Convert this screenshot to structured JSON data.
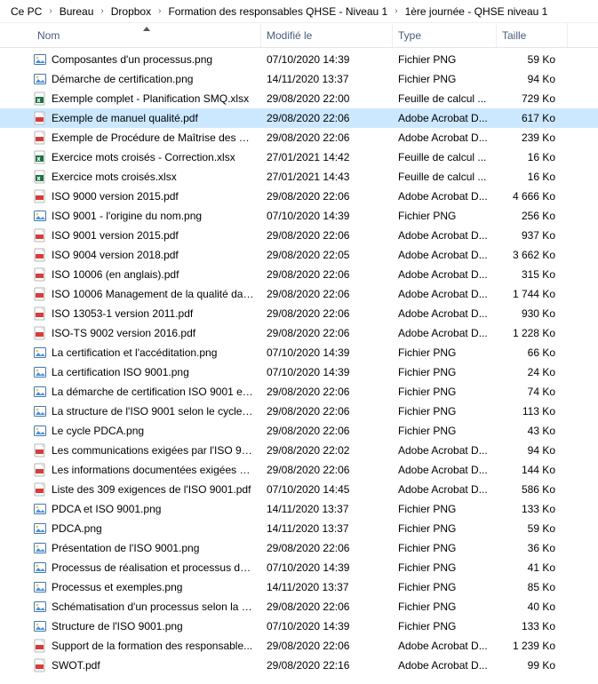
{
  "breadcrumb": [
    "Ce PC",
    "Bureau",
    "Dropbox",
    "Formation des responsables QHSE - Niveau 1",
    "1ère journée - QHSE niveau 1"
  ],
  "columns": {
    "name": "Nom",
    "modified": "Modifié le",
    "type": "Type",
    "size": "Taille"
  },
  "files": [
    {
      "icon": "png",
      "name": "Composantes d'un processus.png",
      "modified": "07/10/2020 14:39",
      "type": "Fichier PNG",
      "size": "59 Ko",
      "selected": false
    },
    {
      "icon": "png",
      "name": "Démarche de certification.png",
      "modified": "14/11/2020 13:37",
      "type": "Fichier PNG",
      "size": "94 Ko",
      "selected": false
    },
    {
      "icon": "xlsx",
      "name": "Exemple complet - Planification SMQ.xlsx",
      "modified": "29/08/2020 22:00",
      "type": "Feuille de calcul ...",
      "size": "729 Ko",
      "selected": false
    },
    {
      "icon": "pdf",
      "name": "Exemple de manuel qualité.pdf",
      "modified": "29/08/2020 22:06",
      "type": "Adobe Acrobat D...",
      "size": "617 Ko",
      "selected": true
    },
    {
      "icon": "pdf",
      "name": "Exemple de Procédure de Maîtrise des do...",
      "modified": "29/08/2020 22:06",
      "type": "Adobe Acrobat D...",
      "size": "239 Ko",
      "selected": false
    },
    {
      "icon": "xlsx",
      "name": "Exercice mots croisés - Correction.xlsx",
      "modified": "27/01/2021 14:42",
      "type": "Feuille de calcul ...",
      "size": "16 Ko",
      "selected": false
    },
    {
      "icon": "xlsx",
      "name": "Exercice mots croisés.xlsx",
      "modified": "27/01/2021 14:43",
      "type": "Feuille de calcul ...",
      "size": "16 Ko",
      "selected": false
    },
    {
      "icon": "pdf",
      "name": "ISO 9000 version 2015.pdf",
      "modified": "29/08/2020 22:06",
      "type": "Adobe Acrobat D...",
      "size": "4 666 Ko",
      "selected": false
    },
    {
      "icon": "png",
      "name": "ISO 9001 - l'origine du nom.png",
      "modified": "07/10/2020 14:39",
      "type": "Fichier PNG",
      "size": "256 Ko",
      "selected": false
    },
    {
      "icon": "pdf",
      "name": "ISO 9001 version 2015.pdf",
      "modified": "29/08/2020 22:06",
      "type": "Adobe Acrobat D...",
      "size": "937 Ko",
      "selected": false
    },
    {
      "icon": "pdf",
      "name": "ISO 9004 version 2018.pdf",
      "modified": "29/08/2020 22:05",
      "type": "Adobe Acrobat D...",
      "size": "3 662 Ko",
      "selected": false
    },
    {
      "icon": "pdf",
      "name": "ISO 10006 (en anglais).pdf",
      "modified": "29/08/2020 22:06",
      "type": "Adobe Acrobat D...",
      "size": "315 Ko",
      "selected": false
    },
    {
      "icon": "pdf",
      "name": "ISO 10006 Management de la qualité dan...",
      "modified": "29/08/2020 22:06",
      "type": "Adobe Acrobat D...",
      "size": "1 744 Ko",
      "selected": false
    },
    {
      "icon": "pdf",
      "name": "ISO 13053-1 version 2011.pdf",
      "modified": "29/08/2020 22:06",
      "type": "Adobe Acrobat D...",
      "size": "930 Ko",
      "selected": false
    },
    {
      "icon": "pdf",
      "name": "ISO-TS 9002 version 2016.pdf",
      "modified": "29/08/2020 22:06",
      "type": "Adobe Acrobat D...",
      "size": "1 228 Ko",
      "selected": false
    },
    {
      "icon": "png",
      "name": "La certification et l'accéditation.png",
      "modified": "07/10/2020 14:39",
      "type": "Fichier PNG",
      "size": "66 Ko",
      "selected": false
    },
    {
      "icon": "png",
      "name": "La certification ISO 9001.png",
      "modified": "07/10/2020 14:39",
      "type": "Fichier PNG",
      "size": "24 Ko",
      "selected": false
    },
    {
      "icon": "png",
      "name": "La démarche de certification ISO 9001 et l...",
      "modified": "29/08/2020 22:06",
      "type": "Fichier PNG",
      "size": "74 Ko",
      "selected": false
    },
    {
      "icon": "png",
      "name": "La structure de l'ISO 9001 selon le cycle P...",
      "modified": "29/08/2020 22:06",
      "type": "Fichier PNG",
      "size": "113 Ko",
      "selected": false
    },
    {
      "icon": "png",
      "name": "Le cycle PDCA.png",
      "modified": "29/08/2020 22:06",
      "type": "Fichier PNG",
      "size": "43 Ko",
      "selected": false
    },
    {
      "icon": "pdf",
      "name": "Les communications exigées par l'ISO 90...",
      "modified": "29/08/2020 22:02",
      "type": "Adobe Acrobat D...",
      "size": "94 Ko",
      "selected": false
    },
    {
      "icon": "pdf",
      "name": "Les informations documentées exigées p...",
      "modified": "29/08/2020 22:06",
      "type": "Adobe Acrobat D...",
      "size": "144 Ko",
      "selected": false
    },
    {
      "icon": "pdf",
      "name": "Liste des 309 exigences de l'ISO 9001.pdf",
      "modified": "07/10/2020 14:45",
      "type": "Adobe Acrobat D...",
      "size": "586 Ko",
      "selected": false
    },
    {
      "icon": "png",
      "name": "PDCA et ISO 9001.png",
      "modified": "14/11/2020 13:37",
      "type": "Fichier PNG",
      "size": "133 Ko",
      "selected": false
    },
    {
      "icon": "png",
      "name": "PDCA.png",
      "modified": "14/11/2020 13:37",
      "type": "Fichier PNG",
      "size": "59 Ko",
      "selected": false
    },
    {
      "icon": "png",
      "name": "Présentation de l'ISO 9001.png",
      "modified": "29/08/2020 22:06",
      "type": "Fichier PNG",
      "size": "36 Ko",
      "selected": false
    },
    {
      "icon": "png",
      "name": "Processus de réalisation et processus de s...",
      "modified": "07/10/2020 14:39",
      "type": "Fichier PNG",
      "size": "41 Ko",
      "selected": false
    },
    {
      "icon": "png",
      "name": "Processus et exemples.png",
      "modified": "14/11/2020 13:37",
      "type": "Fichier PNG",
      "size": "85 Ko",
      "selected": false
    },
    {
      "icon": "png",
      "name": "Schématisation d'un processus selon la d...",
      "modified": "29/08/2020 22:06",
      "type": "Fichier PNG",
      "size": "40 Ko",
      "selected": false
    },
    {
      "icon": "png",
      "name": "Structure de l'ISO 9001.png",
      "modified": "07/10/2020 14:39",
      "type": "Fichier PNG",
      "size": "133 Ko",
      "selected": false
    },
    {
      "icon": "pdf",
      "name": "Support de la formation des responsable...",
      "modified": "29/08/2020 22:06",
      "type": "Adobe Acrobat D...",
      "size": "1 239 Ko",
      "selected": false
    },
    {
      "icon": "pdf",
      "name": "SWOT.pdf",
      "modified": "29/08/2020 22:16",
      "type": "Adobe Acrobat D...",
      "size": "99 Ko",
      "selected": false
    }
  ]
}
